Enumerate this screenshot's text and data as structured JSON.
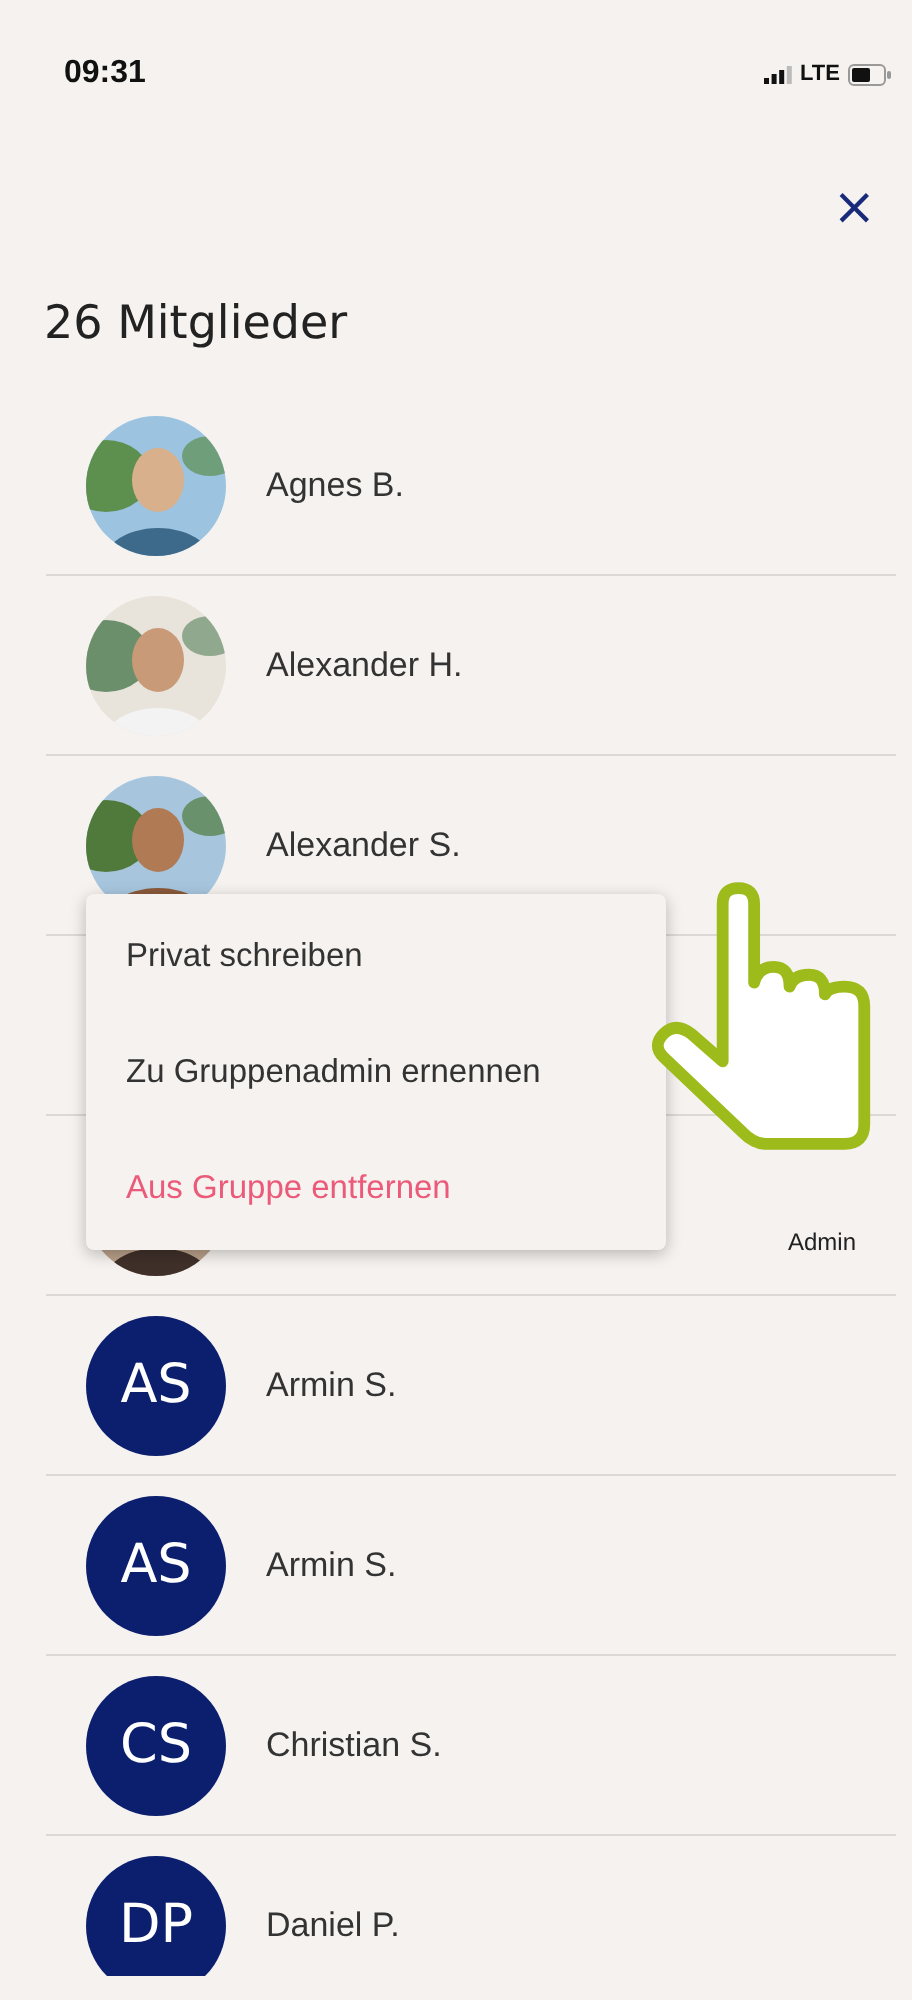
{
  "status_bar": {
    "time": "09:31",
    "network": "LTE"
  },
  "header": {
    "close": "×",
    "title": "26 Mitglieder"
  },
  "members": [
    {
      "name": "Agnes B."
    },
    {
      "name": "Alexander H."
    },
    {
      "name": "Alexander S."
    },
    {
      "kind": "blank"
    },
    {
      "badge": "Admin"
    },
    {
      "kind": "initials",
      "initials": "AS",
      "name": "Armin S."
    },
    {
      "kind": "initials",
      "initials": "AS",
      "name": "Armin S."
    },
    {
      "kind": "initials",
      "initials": "CS",
      "name": "Christian S."
    },
    {
      "kind": "initials",
      "initials": "DP",
      "name": "Daniel P."
    }
  ],
  "context_menu": {
    "items": [
      {
        "label": "Privat schreiben",
        "kind": "normal"
      },
      {
        "label": "Zu Gruppenadmin ernennen",
        "kind": "normal"
      },
      {
        "label": "Aus Gruppe entfernen",
        "kind": "danger"
      }
    ]
  }
}
